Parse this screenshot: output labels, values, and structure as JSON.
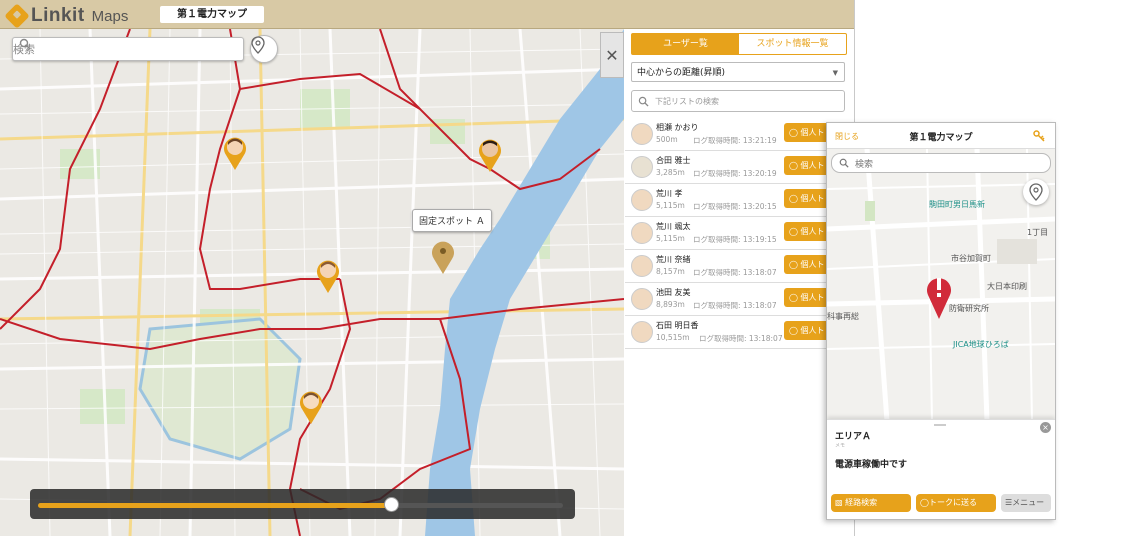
{
  "header": {
    "brand": "Linkit",
    "brand_sub": "Maps",
    "map_title": "第１電力マップ"
  },
  "map": {
    "search_placeholder": "検索",
    "spot_label": "固定スポット Ａ",
    "timeline_progress": 0.67
  },
  "panel": {
    "tabs": [
      {
        "label": "ユーザー覧",
        "active": true
      },
      {
        "label": "スポット情報一覧",
        "active": false
      }
    ],
    "sort_value": "中心からの距離(昇順)",
    "filter_placeholder": "下記リストの検索",
    "users": [
      {
        "name": "相瀬 かおり",
        "distance": "500m",
        "log": "ログ取得時間: 13:21:19",
        "button": "個人ト"
      },
      {
        "name": "合田 雅士",
        "distance": "3,285m",
        "log": "ログ取得時間: 13:20:19",
        "button": "個人ト"
      },
      {
        "name": "荒川 孝",
        "distance": "5,115m",
        "log": "ログ取得時間: 13:20:15",
        "button": "個人ト"
      },
      {
        "name": "荒川 颯太",
        "distance": "5,115m",
        "log": "ログ取得時間: 13:19:15",
        "button": "個人ト"
      },
      {
        "name": "荒川 奈緒",
        "distance": "8,157m",
        "log": "ログ取得時間: 13:18:07",
        "button": "個人ト"
      },
      {
        "name": "池田 友美",
        "distance": "8,893m",
        "log": "ログ取得時間: 13:18:07",
        "button": "個人ト"
      },
      {
        "name": "石田 明日香",
        "distance": "10,515m",
        "log": "ログ取得時間: 13:18:07",
        "button": "個人ト"
      }
    ]
  },
  "mobile": {
    "close_label": "閉じる",
    "title": "第１電力マップ",
    "search_placeholder": "検索",
    "map_labels": {
      "station": "市谷加賀町",
      "landmark": "防衛研究所",
      "park": "JICA地球ひろば",
      "print": "大日本印刷",
      "school": "駒田町男日馬新",
      "chome": "1丁目",
      "misc": "科事再総"
    },
    "sheet": {
      "area": "エリアＡ",
      "memo": "メモ",
      "status": "電源車稼働中です",
      "buttons": [
        {
          "label": "経路検索"
        },
        {
          "label": "トークに送る"
        },
        {
          "label": "メニュー"
        }
      ]
    }
  },
  "colors": {
    "accent": "#e7a21b",
    "route": "#c41f2a",
    "header_bg": "#d8c9a5"
  }
}
